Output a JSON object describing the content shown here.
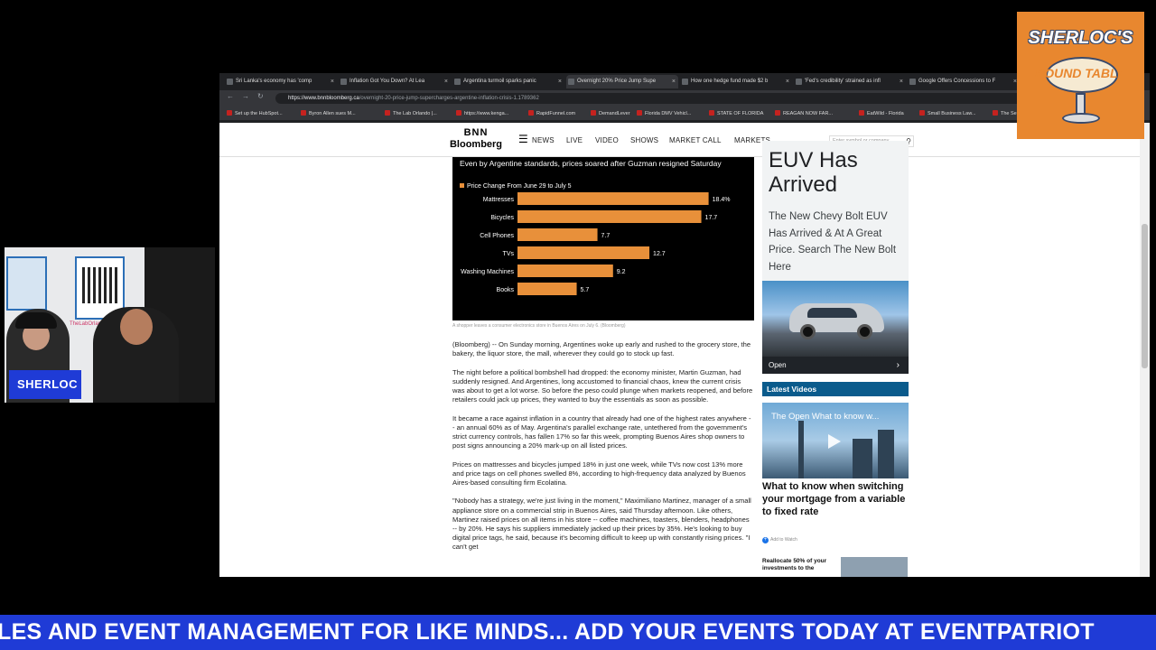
{
  "browser": {
    "tabs": [
      {
        "label": "Sri Lanka's economy has 'comp",
        "active": false
      },
      {
        "label": "Inflation Got You Down? At Lea",
        "active": false
      },
      {
        "label": "Argentina turmoil sparks panic",
        "active": false
      },
      {
        "label": "Overnight 20% Price Jump Supe",
        "active": true
      },
      {
        "label": "How one hedge fund made $2 b",
        "active": false
      },
      {
        "label": "'Fed's credibility' strained as infl",
        "active": false
      },
      {
        "label": "Google Offers Concessions to F",
        "active": false
      }
    ],
    "url_host": "https://www.bnnbloomberg.ca",
    "url_path": "/overnight-20-price-jump-supercharges-argentine-inflation-crisis-1.1789362",
    "bookmarks": [
      "Set up the HubSpot...",
      "Byron Allen sues M...",
      "The Lab Orlando |...",
      "https://www.kenga...",
      "RapidFunnel.com",
      "DemandLever",
      "Florida DMV Vehicl...",
      "STATE OF FLORIDA",
      "REAGAN NOW FAR...",
      "EatWild - Florida",
      "Small Business Law...",
      "The Secr"
    ]
  },
  "site": {
    "logo_top": "BNN",
    "logo_bottom": "Bloomberg",
    "nav": [
      "NEWS",
      "LIVE",
      "VIDEO",
      "SHOWS",
      "MARKET CALL",
      "MARKETS"
    ],
    "search_placeholder": "Enter symbol or company"
  },
  "chart_data": {
    "type": "bar",
    "subtitle": "Even by Argentine standards, prices soared after Guzman resigned Saturday",
    "legend": "Price Change From June 29 to July 5",
    "categories": [
      "Mattresses",
      "Bicycles",
      "Cell Phones",
      "TVs",
      "Washing Machines",
      "Books"
    ],
    "values": [
      18.4,
      17.7,
      7.7,
      12.7,
      9.2,
      5.7
    ],
    "value_labels": [
      "18.4%",
      "17.7",
      "7.7",
      "12.7",
      "9.2",
      "5.7"
    ],
    "bar_color": "#e8903a",
    "xlim": [
      0,
      20
    ]
  },
  "caption": "A shopper leaves a consumer electronics store in Buenos Aires on July 6.  (Bloomberg)",
  "article": [
    "(Bloomberg) -- On Sunday morning, Argentines woke up early and rushed to the grocery store, the bakery, the liquor store, the mall, wherever they could go to stock up fast.",
    "The night before a political bombshell had dropped: the economy minister, Martin Guzman, had suddenly resigned. And Argentines, long accustomed to financial chaos, knew the current crisis was about to get a lot worse. So before the peso could plunge when markets reopened, and before retailers could jack up prices, they wanted to buy the essentials as soon as possible.",
    "It became a race against inflation in a country that already had one of the highest rates anywhere -- an annual 60% as of May. Argentina's parallel exchange rate, untethered from the government's strict currency controls, has fallen 17% so far this week, prompting Buenos Aires shop owners to post signs announcing a 20% mark-up on all listed prices.",
    "Prices on mattresses and bicycles jumped 18% in just one week, while TVs now cost 13% more and price tags on cell phones swelled 8%, according to high-frequency data analyzed by Buenos Aires-based consulting firm Ecolatina.",
    "\"Nobody has a strategy, we're just living in the moment,\" Maximiliano Martinez, manager of a small appliance store on a commercial strip in Buenos Aires, said Thursday afternoon. Like others, Martinez raised prices on all items in his store -- coffee machines, toasters, blenders, headphones -- by 20%. He says his suppliers immediately jacked up their prices by 35%. He's looking to buy digital price tags, he said, because it's becoming difficult to keep up with constantly rising prices. \"I can't get"
  ],
  "ad": {
    "headline_1": "EUV Has",
    "headline_2": "Arrived",
    "body": "The New Chevy Bolt EUV Has Arrived & At A Great Price. Search The New Bolt Here",
    "open_label": "Open"
  },
  "latest_videos": {
    "header": "Latest Videos",
    "video1_overlay": "The Open What to know w...",
    "video1_title": "What to know when switching your mortgage from a variable to fixed rate",
    "watch_later": "Add to Watch",
    "video2_title": "Reallocate 50% of your investments to the"
  },
  "webcam": {
    "name": "SHERLOC",
    "sign_text": "TheLabOrlando"
  },
  "show_logo": {
    "title": "SHERLOC'S",
    "subtitle": "ROUND TABLE"
  },
  "ticker": "LES AND EVENT MANAGEMENT FOR LIKE MINDS... ADD YOUR EVENTS TODAY AT EVENTPATRIOT"
}
